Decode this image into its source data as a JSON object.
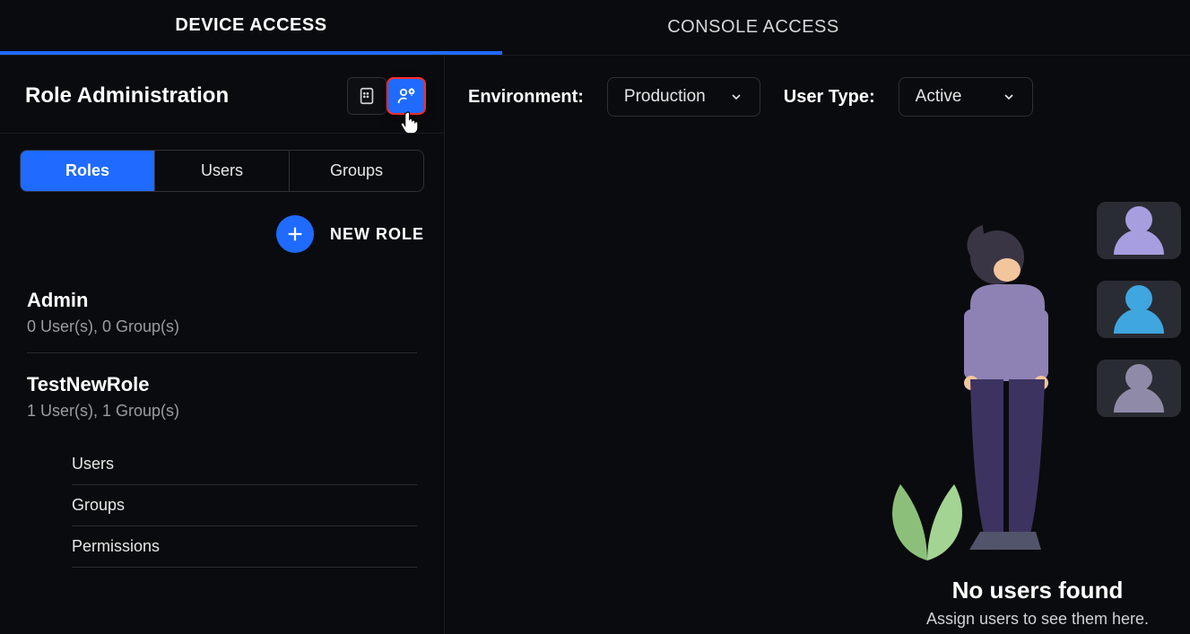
{
  "tabs": {
    "device_access": "DEVICE ACCESS",
    "console_access": "CONSOLE ACCESS"
  },
  "sidebar": {
    "title": "Role Administration",
    "segments": {
      "roles": "Roles",
      "users": "Users",
      "groups": "Groups"
    },
    "new_role_label": "NEW ROLE",
    "roles": [
      {
        "name": "Admin",
        "subtitle": "0 User(s), 0 Group(s)"
      },
      {
        "name": "TestNewRole",
        "subtitle": "1 User(s), 1 Group(s)"
      }
    ],
    "sublinks": {
      "users": "Users",
      "groups": "Groups",
      "permissions": "Permissions"
    }
  },
  "filters": {
    "environment_label": "Environment:",
    "environment_value": "Production",
    "user_type_label": "User Type:",
    "user_type_value": "Active"
  },
  "empty_state": {
    "title": "No users found",
    "subtitle": "Assign users to see them here."
  }
}
